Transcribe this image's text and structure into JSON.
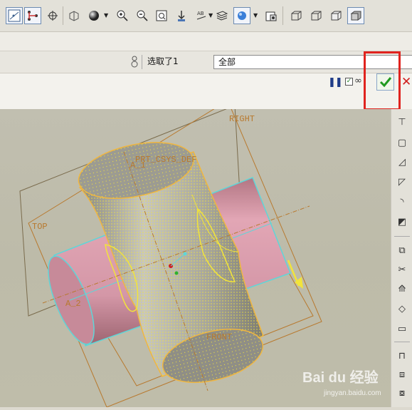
{
  "toolbar": {
    "icons": [
      "datum-display-icon",
      "datum-axis-icon",
      "spin-center-icon",
      "wireframe-icon",
      "shading-icon",
      "zoom-in-icon",
      "zoom-out-icon",
      "refit-icon",
      "reorient-icon",
      "view-manager-icon",
      "layers-icon",
      "appearance-icon",
      "screenshot-icon",
      "hidden-line-icon",
      "no-hidden-icon",
      "shaded-edges-icon",
      "shaded-icon"
    ]
  },
  "selection": {
    "label": "选取了1",
    "filter_value": "全部"
  },
  "datums": {
    "right": "RIGHT",
    "top": "TOP",
    "front": "FRONT",
    "csys": "PRT_CSYS_DEF",
    "axis1": "A_1",
    "axis2": "A_2"
  },
  "colors": {
    "accent_green": "#1f9a1f",
    "cancel_red": "#d0201e",
    "highlight_red": "#e0231e",
    "datum_orange": "#b8792e",
    "pipe_pink": "#d79aaa",
    "edge_cyan": "#5fd6d8",
    "mesh_yellow": "#f2e43a"
  },
  "watermark": {
    "brand": "Bai du 经验",
    "url": "jingyan.baidu.com"
  }
}
